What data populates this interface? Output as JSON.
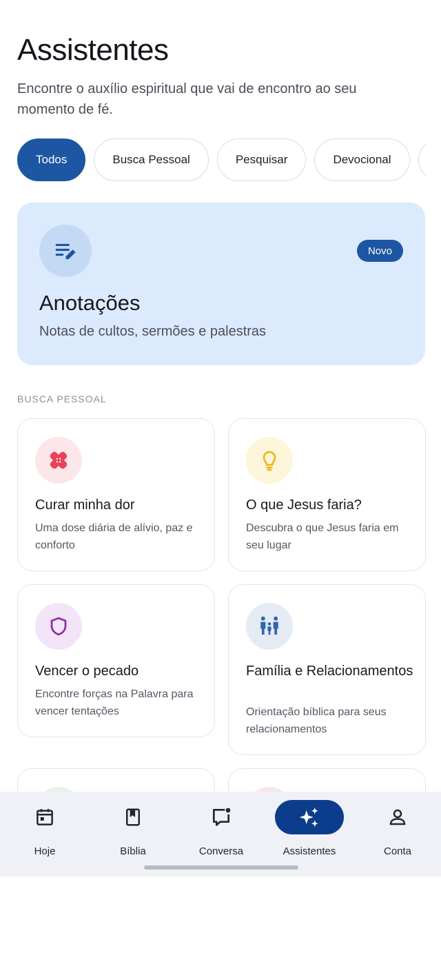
{
  "header": {
    "title": "Assistentes",
    "subtitle": "Encontre o auxílio espiritual que vai de encontro ao seu momento de fé."
  },
  "filters": [
    {
      "label": "Todos",
      "active": true
    },
    {
      "label": "Busca Pessoal",
      "active": false
    },
    {
      "label": "Pesquisar",
      "active": false
    },
    {
      "label": "Devocional",
      "active": false
    },
    {
      "label": "",
      "active": false
    }
  ],
  "featured": {
    "icon": "notes-edit-icon",
    "badge": "Novo",
    "title": "Anotações",
    "description": "Notas de cultos, sermões e palestras"
  },
  "section": {
    "label": "BUSCA PESSOAL"
  },
  "cards": [
    {
      "icon": "bandage-icon",
      "title": "Curar minha dor",
      "description": "Uma dose diária de alívio, paz e conforto"
    },
    {
      "icon": "lightbulb-icon",
      "title": "O que Jesus faria?",
      "description": "Descubra o que Jesus faria em seu lugar"
    },
    {
      "icon": "shield-icon",
      "title": "Vencer o pecado",
      "description": "Encontre forças na Palavra para vencer tentações"
    },
    {
      "icon": "family-icon",
      "title": "Família e Relacionamentos",
      "description": "Orientação bíblica para seus relacionamentos"
    }
  ],
  "nav": {
    "items": [
      {
        "label": "Hoje",
        "icon": "calendar-icon"
      },
      {
        "label": "Bíblia",
        "icon": "bible-icon"
      },
      {
        "label": "Conversa",
        "icon": "chat-icon"
      },
      {
        "label": "Assistentes",
        "icon": "sparkles-icon",
        "active": true
      },
      {
        "label": "Conta",
        "icon": "user-icon"
      }
    ]
  },
  "colors": {
    "primary": "#1d56a3",
    "nav_active": "#0b3d8c",
    "featured_bg": "#dceafd"
  }
}
